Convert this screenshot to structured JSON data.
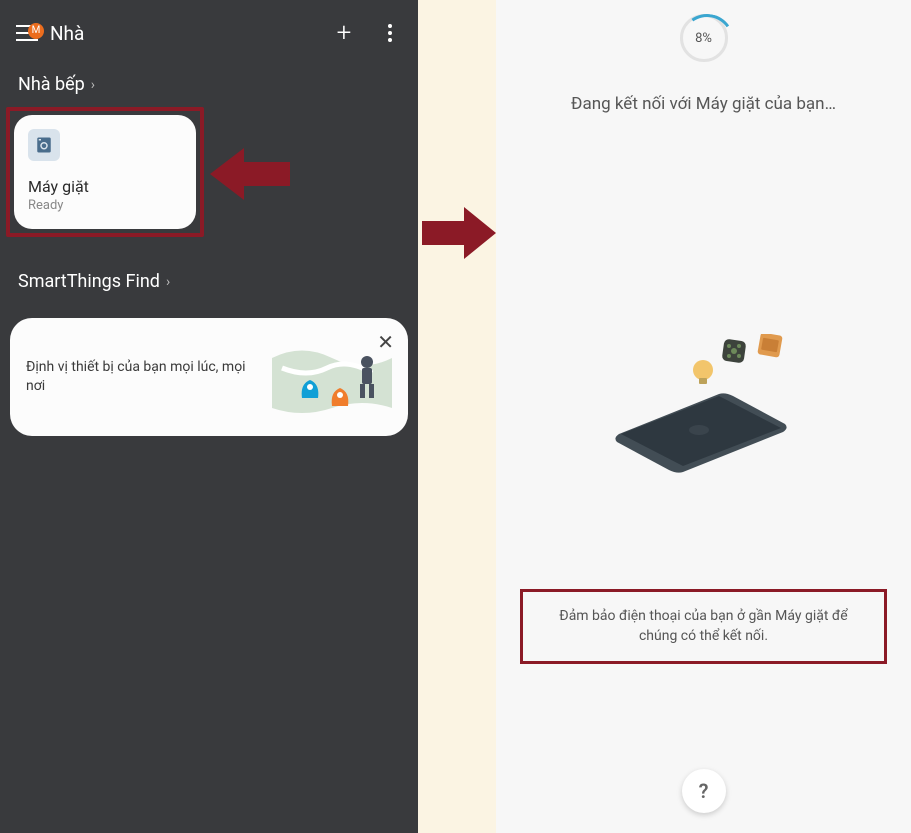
{
  "left": {
    "header": {
      "menu_badge": "M",
      "title": "Nhà"
    },
    "section1": {
      "label": "Nhà bếp"
    },
    "device": {
      "name": "Máy giặt",
      "status": "Ready"
    },
    "section2": {
      "label": "SmartThings Find"
    },
    "find_card": {
      "text": "Định vị thiết bị của bạn mọi lúc, mọi nơi"
    }
  },
  "right": {
    "progress": "8%",
    "connecting": "Đang kết nối với Máy giặt của bạn…",
    "instruction": "Đảm bảo điện thoại của bạn ở gần Máy giặt để chúng có thể kết nối.",
    "help": "?"
  }
}
